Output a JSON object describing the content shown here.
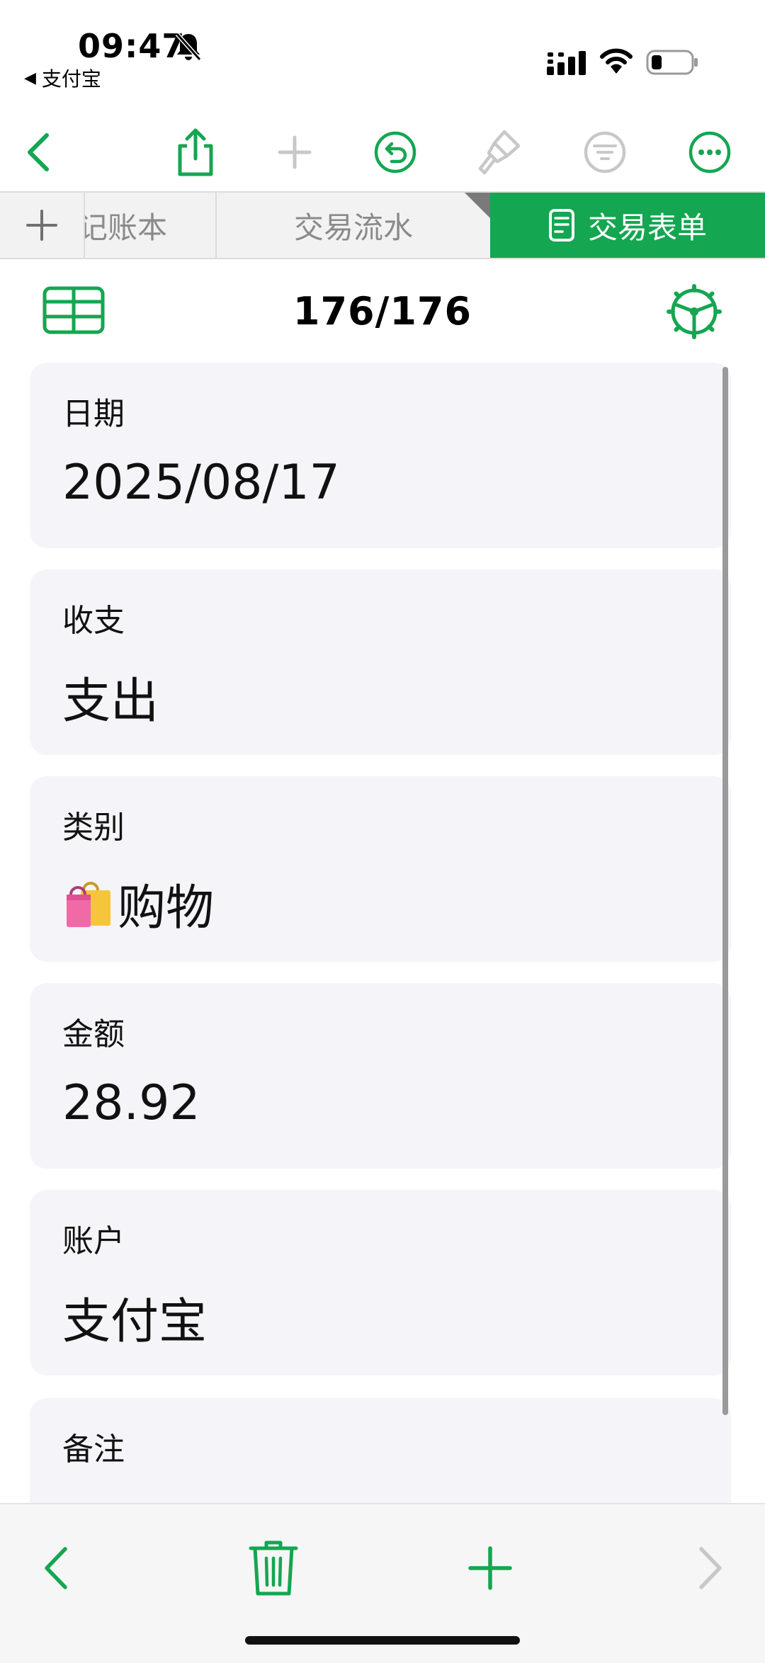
{
  "status_bar": {
    "time": "09:47",
    "back_app": "支付宝",
    "icons": [
      "bell-slash-icon",
      "cellular-signal-icon",
      "wifi-icon",
      "battery-icon"
    ]
  },
  "toolbar": {
    "icons": [
      "back-chevron-icon",
      "share-icon",
      "add-icon",
      "undo-icon",
      "paintbrush-icon",
      "filter-icon",
      "more-icon"
    ],
    "accent_color": "#14a651"
  },
  "tabs": {
    "add_label": "+",
    "items": [
      {
        "label": "记账本"
      },
      {
        "label": "交易流水"
      },
      {
        "label": "交易表单",
        "active": true
      }
    ]
  },
  "form": {
    "counter": "176/176",
    "fields": [
      {
        "label": "日期",
        "value": "2025/08/17"
      },
      {
        "label": "收支",
        "value": "支出"
      },
      {
        "label": "类别",
        "value": "购物",
        "emoji": "shopping-bags"
      },
      {
        "label": "金额",
        "value": "28.92"
      },
      {
        "label": "账户",
        "value": "支付宝"
      },
      {
        "label": "备注",
        "value": ""
      }
    ]
  },
  "bottom_bar": {
    "icons": [
      "previous-record-icon",
      "delete-icon",
      "add-record-icon",
      "next-record-icon"
    ]
  }
}
